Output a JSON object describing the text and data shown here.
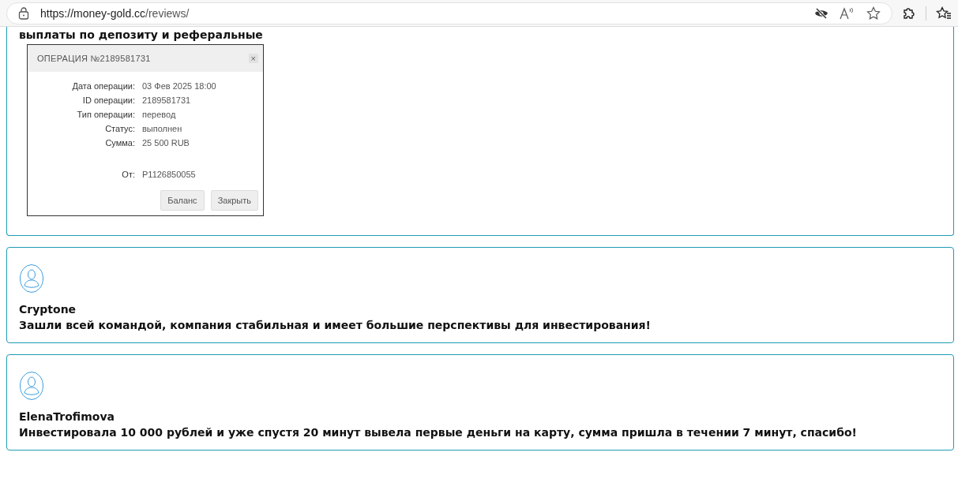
{
  "browser": {
    "url_host": "https://money-gold.cc",
    "url_path": "/reviews/"
  },
  "first_review": {
    "text": "выплаты по депозиту и реферальные",
    "receipt": {
      "title": "ОПЕРАЦИЯ №2189581731",
      "close": "×",
      "fields": [
        {
          "label": "Дата операции:",
          "value": "03 Фев 2025 18:00"
        },
        {
          "label": "ID операции:",
          "value": "2189581731"
        },
        {
          "label": "Тип операции:",
          "value": "перевод"
        },
        {
          "label": "Статус:",
          "value": "выполнен"
        },
        {
          "label": "Сумма:",
          "value": "25 500 RUB"
        },
        {
          "label": "От:",
          "value": "P1126850055"
        }
      ],
      "buttons": [
        "Баланс",
        "Закрыть"
      ]
    }
  },
  "reviews": [
    {
      "author": "Cryptone",
      "text": "Зашли всей командой, компания стабильная и имеет большие перспективы для инвестирования!"
    },
    {
      "author": "ElenaTrofimova",
      "text": "Инвестировала 10 000 рублей и уже спустя 20 минут вывела первые деньги на карту, сумма пришла в течении 7 минут, спасибо!"
    }
  ]
}
